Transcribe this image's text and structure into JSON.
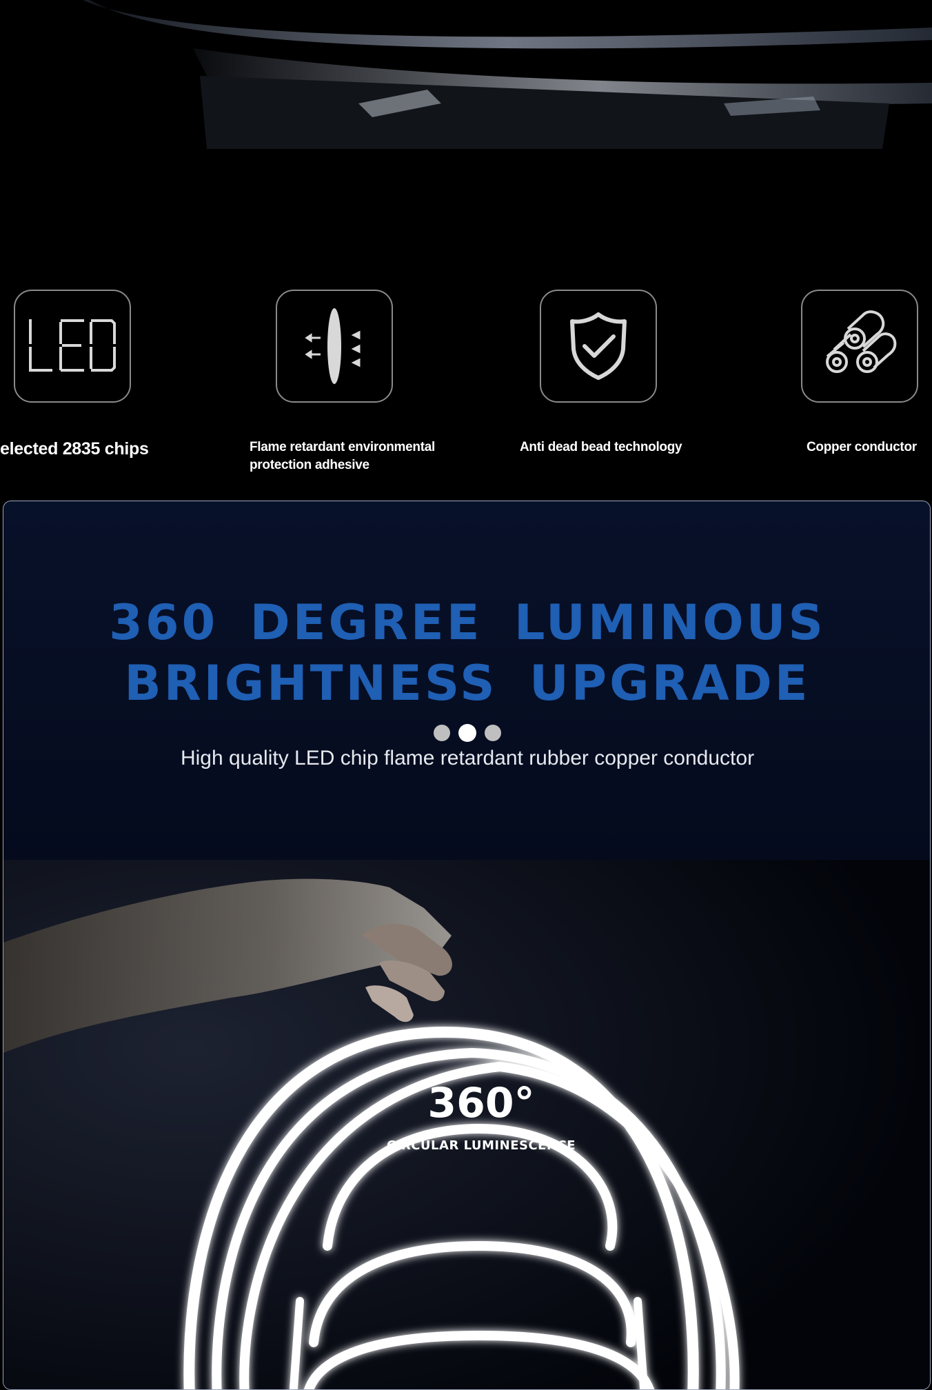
{
  "features": [
    {
      "icon": "led-display-icon",
      "label": "elected 2835 chips"
    },
    {
      "icon": "lens-icon",
      "label": "Flame retardant environmental protection adhesive"
    },
    {
      "icon": "shield-check-icon",
      "label": "Anti dead bead technology"
    },
    {
      "icon": "copper-rolls-icon",
      "label": "Copper conductor"
    }
  ],
  "led_icon_text": "LED",
  "headline": {
    "line1": "360 DEGREE LUMINOUS",
    "line2": "BRIGHTNESS UPGRADE"
  },
  "subtitle": "High quality LED chip flame retardant rubber copper conductor",
  "carousel": {
    "count": 3,
    "active_index": 1
  },
  "badge": {
    "value": "360°",
    "caption": "CIRCULAR LUMINESCENCE"
  },
  "colors": {
    "headline": "#1f5fb4",
    "background": "#000000",
    "panel": "#060c20"
  }
}
